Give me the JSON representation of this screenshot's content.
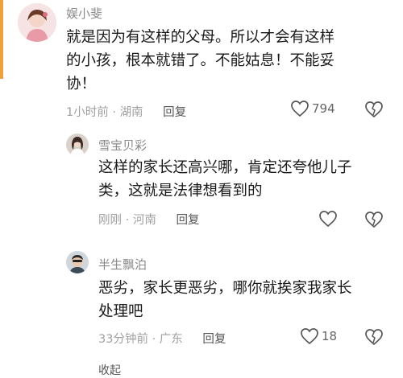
{
  "comments": [
    {
      "username": "娱小斐",
      "lines": [
        "就是因为有这样的父母。所以才会有这样",
        "的小孩，根本就错了。不能姑息！不能妥",
        "协！"
      ],
      "time": "1小时前",
      "location": "湖南",
      "reply_label": "回复",
      "like_count": "794"
    },
    {
      "username": "雪宝贝彩",
      "lines": [
        "这样的家长还高兴哪，肯定还夸他儿子",
        "类，这就是法律想看到的"
      ],
      "time": "刚刚",
      "location": "河南",
      "reply_label": "回复",
      "like_count": ""
    },
    {
      "username": "半生飘泊",
      "lines": [
        "恶劣，家长更恶劣，哪你就挨家我家长",
        "处理吧"
      ],
      "time": "33分钟前",
      "location": "广东",
      "reply_label": "回复",
      "like_count": "18"
    }
  ],
  "footer": {
    "collapse_label": "收起"
  },
  "colors": {
    "accent": "#f0a03a",
    "meta_text": "#a0a0a0",
    "username": "#8a8a8a"
  },
  "icons": [
    "heart-outline-icon",
    "broken-heart-icon"
  ]
}
